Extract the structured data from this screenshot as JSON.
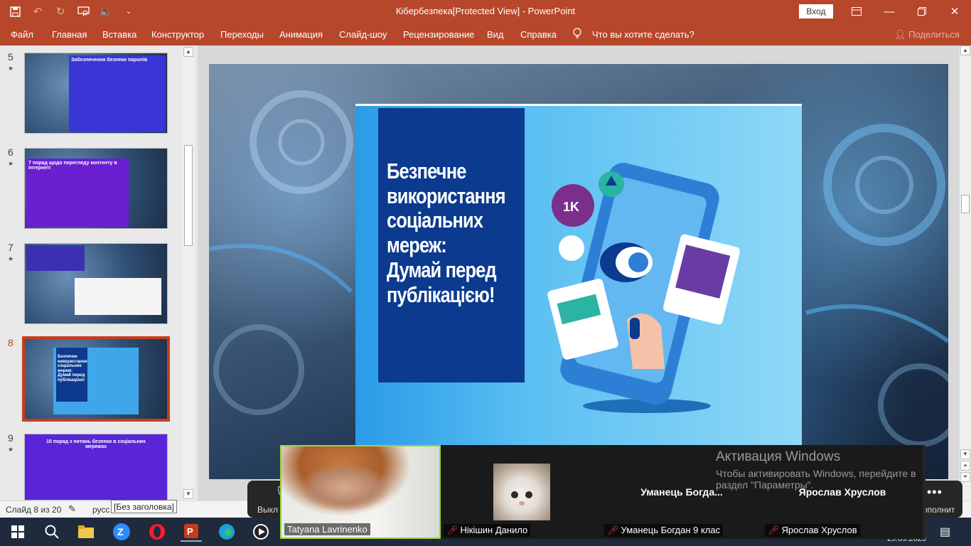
{
  "titlebar": {
    "title": "Кібербезпека[Protected View]  -  PowerPoint",
    "login": "Вход",
    "icons": [
      "save-icon",
      "undo-icon",
      "redo-icon",
      "present-icon",
      "volume-icon",
      "customize-icon"
    ]
  },
  "ribbon": {
    "tabs": [
      "Файл",
      "Главная",
      "Вставка",
      "Конструктор",
      "Переходы",
      "Анимация",
      "Слайд-шоу",
      "Рецензирование",
      "Вид",
      "Справка",
      "Что вы хотите сделать?"
    ],
    "share": "Поделиться"
  },
  "thumbnails": [
    {
      "num": "5",
      "star": "★",
      "banner": "Забезпечення безпеки паролів"
    },
    {
      "num": "6",
      "star": "★",
      "banner": "7 порад щодо перегляду контенту в Інтернеті"
    },
    {
      "num": "7",
      "star": "★",
      "banner": ""
    },
    {
      "num": "8",
      "star": "",
      "banner": "Безпечне використання соціальних мереж: Думай перед публікацією!"
    },
    {
      "num": "9",
      "star": "★",
      "banner": "10 порад з питань безпеки в соціальних мережах"
    }
  ],
  "slide": {
    "title": "Безпечне використання соціальних мереж: Думай перед публікацією!",
    "badge": "1K"
  },
  "statusbar": {
    "counter": "Слайд 8 из 20",
    "lang": "русс",
    "tooltip": "[Без заголовка]"
  },
  "zoom": {
    "mute_label": "Выкл",
    "more_label": "ополнит",
    "participants": [
      {
        "name": "Tatyana Lavrinenko",
        "big": "",
        "muted": false
      },
      {
        "name": "Нікішин Данило",
        "big": "",
        "muted": true
      },
      {
        "name": "Уманець Богдан 9 клас",
        "big": "Уманець  Богда...",
        "muted": true
      },
      {
        "name": "Ярослав Хруслов",
        "big": "Ярослав Хруслов",
        "muted": true
      }
    ]
  },
  "activation": {
    "title": "Активация Windows",
    "line1": "Чтобы активировать Windows, перейдите в",
    "line2": "раздел \"Параметры\"."
  },
  "taskbar": {
    "clock": "29.09.2023"
  },
  "colors": {
    "accent": "#b7472a",
    "active_slide": "#c43e1c",
    "title_panel": "#0b3a8f",
    "speaker_border": "#9ad33f"
  }
}
